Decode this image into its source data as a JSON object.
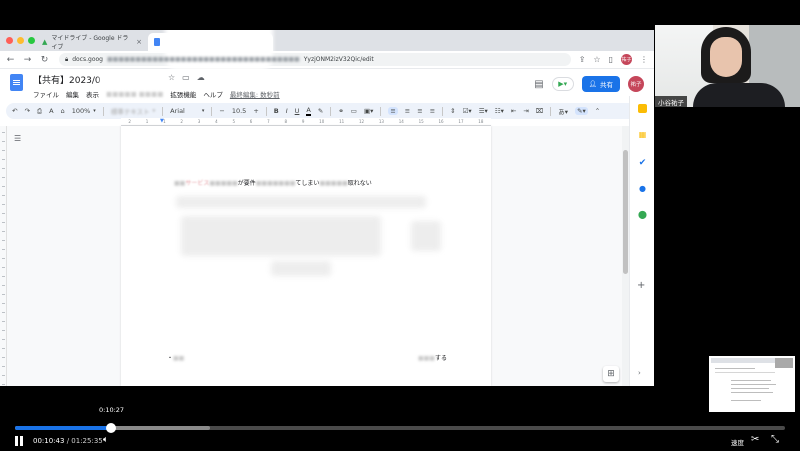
{
  "browser": {
    "tabs": [
      {
        "title": "マイドライブ - Google ドライブ",
        "close": "×"
      },
      {
        "title": "",
        "close": ""
      }
    ],
    "url_visible": "docs.goog",
    "url_end": "YyzjONM2izV32Qic/edit",
    "nav_icons": [
      "back-arrow-icon",
      "forward-arrow-icon",
      "reload-icon"
    ],
    "profile_initials": "祐子"
  },
  "docs": {
    "title": "【共有】2023/0",
    "menu": [
      "ファイル",
      "編集",
      "表示",
      "拡張機能",
      "ヘルプ"
    ],
    "last_edit": "最終編集: 数秒前",
    "share_label": "共有",
    "user_initials": "祐子",
    "toolbar": {
      "zoom": "100%",
      "style": "標準テキスト",
      "font": "Arial",
      "font_size": "10.5",
      "minus": "−",
      "plus": "+"
    },
    "ruler_numbers": [
      "2",
      "1",
      "1",
      "2",
      "3",
      "4",
      "5",
      "6",
      "7",
      "8",
      "9",
      "10",
      "11",
      "12",
      "13",
      "14",
      "15",
      "16",
      "17",
      "18"
    ],
    "content": {
      "line1_a": "サービス",
      "line1_b": "が要件",
      "line1_c": "てしまい",
      "line1_end": "取れない",
      "bottom_start": "・",
      "bottom_end": "する"
    }
  },
  "webcam": {
    "name": "小谷祐子"
  },
  "player": {
    "hover_time": "0:10:27",
    "current_time": "00:10:43",
    "separator": "/",
    "total_time": "01:25:35",
    "progress_fraction": 0.125,
    "buffered_fraction": 0.253,
    "speed_label": "速度",
    "accent": "#1a73e8"
  }
}
